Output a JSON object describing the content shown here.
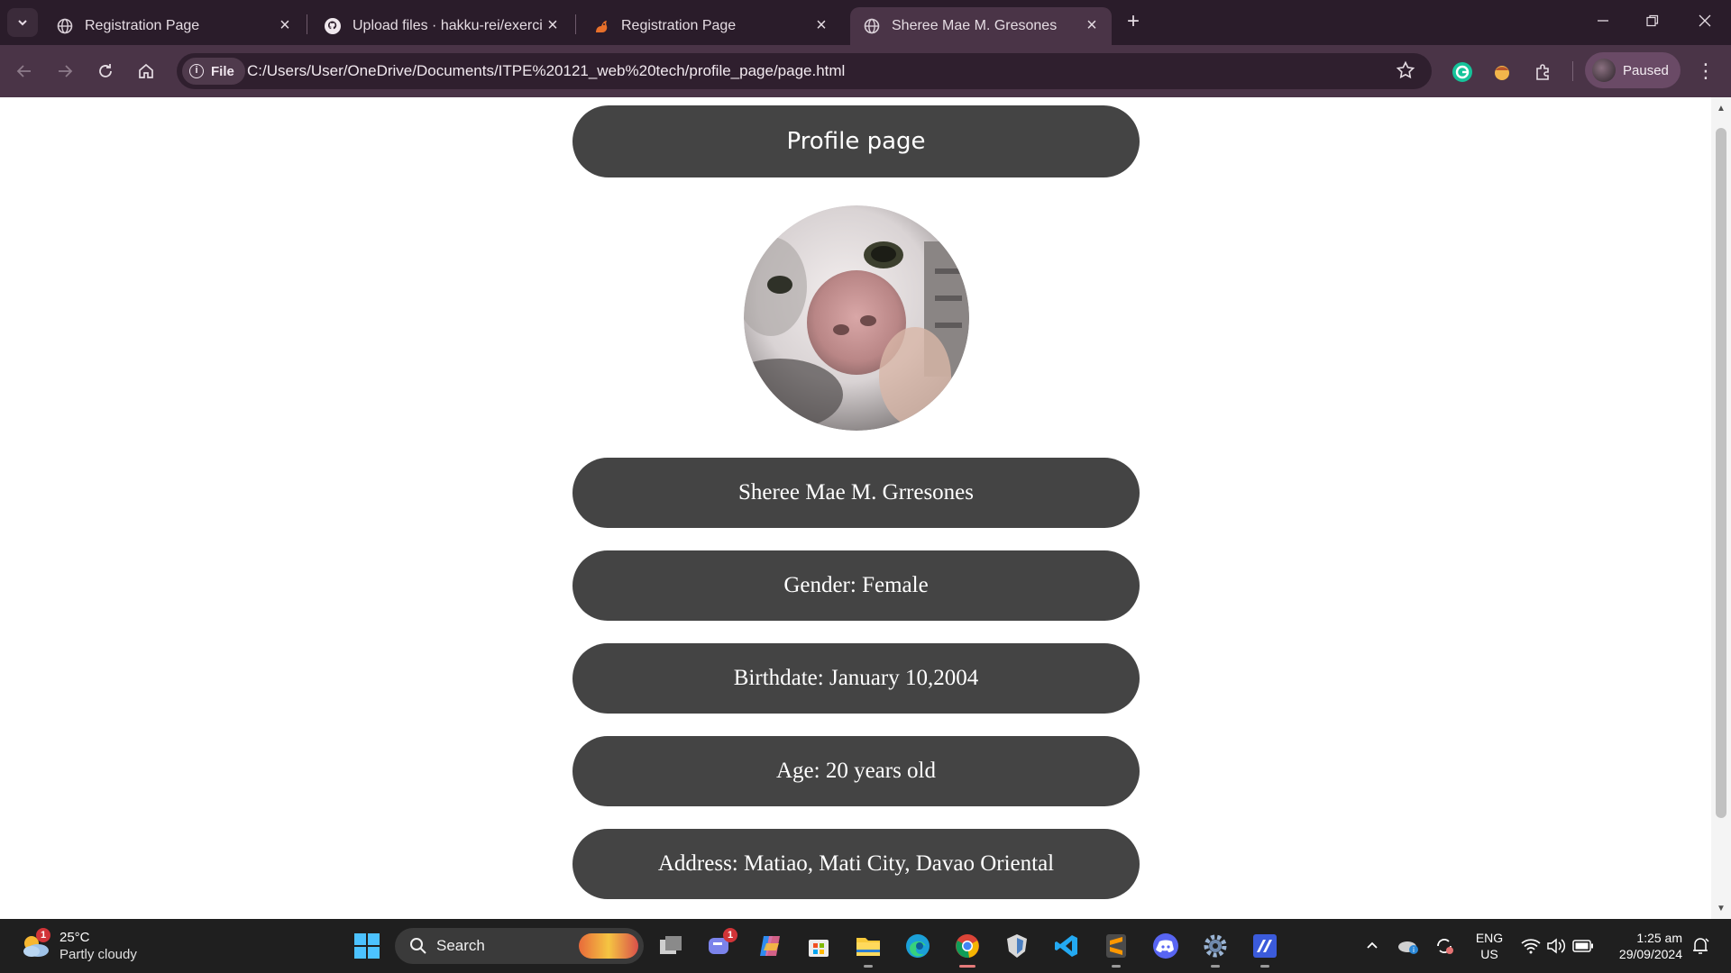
{
  "browser": {
    "tabs": [
      {
        "title": "Registration Page",
        "icon": "globe-icon",
        "active": false
      },
      {
        "title": "Upload files · hakku-rei/exercise",
        "icon": "github-icon",
        "active": false
      },
      {
        "title": "Registration Page",
        "icon": "squirrel-icon",
        "active": false
      },
      {
        "title": "Sheree Mae M. Gresones",
        "icon": "globe-icon",
        "active": true
      }
    ],
    "address_chip": "File",
    "url": "C:/Users/User/OneDrive/Documents/ITPE%20121_web%20tech/profile_page/page.html",
    "profile_status": "Paused"
  },
  "page": {
    "heading": "Profile page",
    "avatar_alt": "cat photo",
    "fields": [
      {
        "text": "Sheree Mae M. Grresones"
      },
      {
        "text": "Gender: Female"
      },
      {
        "text": "Birthdate: January 10,2004"
      },
      {
        "text": "Age: 20 years old"
      },
      {
        "text": "Address: Matiao, Mati City, Davao Oriental"
      }
    ]
  },
  "taskbar": {
    "weather": {
      "temp": "25°C",
      "condition": "Partly cloudy",
      "badge": "1"
    },
    "search_label": "Search",
    "teams_badge": "1",
    "language": {
      "line1": "ENG",
      "line2": "US"
    },
    "clock": {
      "time": "1:25 am",
      "date": "29/09/2024"
    }
  },
  "colors": {
    "pill_bg": "#444444",
    "tabstrip_bg": "#2a1c2a",
    "toolbar_bg": "#4a3447",
    "taskbar_bg": "#1f1f1f"
  }
}
